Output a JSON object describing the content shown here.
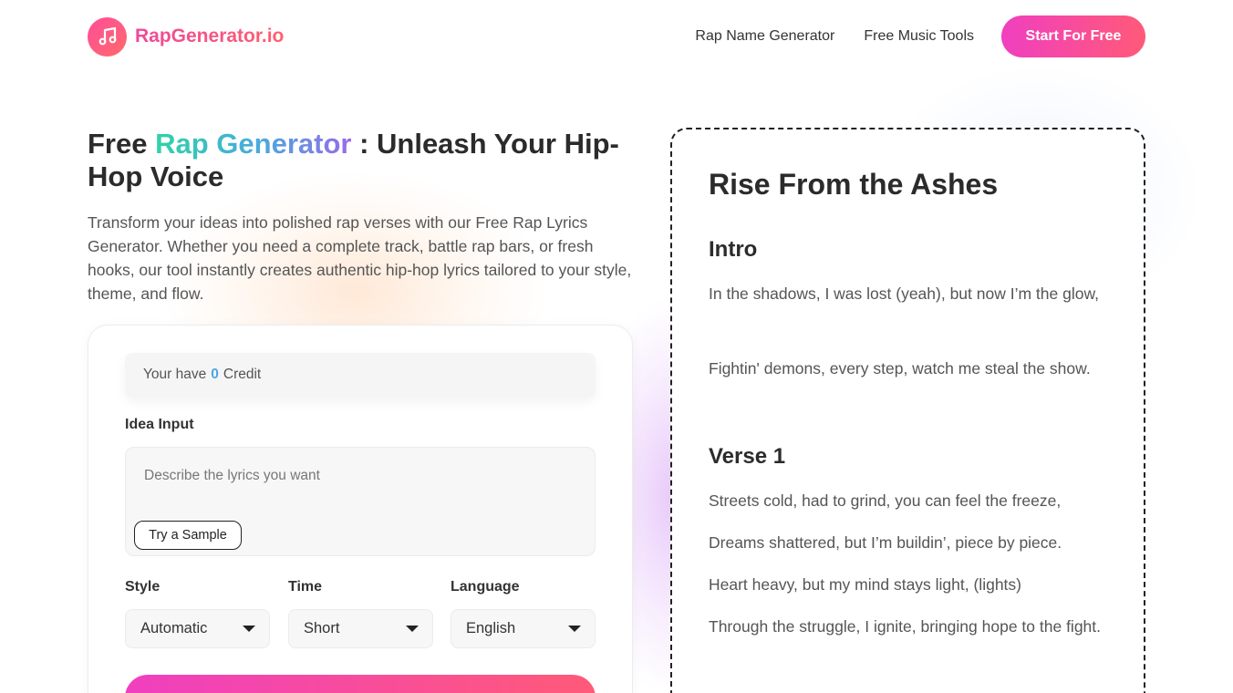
{
  "header": {
    "logo_text": "RapGenerator.io",
    "logo_icon": "music-note-icon",
    "nav": [
      {
        "label": "Rap Name Generator"
      },
      {
        "label": "Free Music Tools"
      }
    ],
    "cta_label": "Start For Free"
  },
  "hero": {
    "title_before": "Free ",
    "title_highlight": "Rap Generator",
    "title_after": " : Unleash Your Hip-Hop Voice",
    "description": "Transform your ideas into polished rap verses with our Free Rap Lyrics Generator. Whether you need a complete track, battle rap bars, or fresh hooks, our tool instantly creates authentic hip-hop lyrics tailored to your style, theme, and flow."
  },
  "form": {
    "credit_prefix": "Your have",
    "credit_count": "0",
    "credit_suffix": "Credit",
    "idea_label": "Idea Input",
    "idea_placeholder": "Describe the lyrics you want",
    "sample_button": "Try a Sample",
    "style_label": "Style",
    "style_value": "Automatic",
    "time_label": "Time",
    "time_value": "Short",
    "language_label": "Language",
    "language_value": "English"
  },
  "song": {
    "title": "Rise From the Ashes",
    "sections": [
      {
        "heading": "Intro",
        "lines": [
          "In the shadows, I was lost (yeah), but now I’m the glow,",
          "Fightin' demons, every step, watch me steal the show."
        ]
      },
      {
        "heading": "Verse 1",
        "lines": [
          "Streets cold, had to grind, you can feel the freeze,",
          "Dreams shattered, but I’m buildin’, piece by piece.",
          "Heart heavy, but my mind stays light, (lights)",
          "Through the struggle, I ignite, bringing hope to the fight."
        ]
      }
    ]
  },
  "colors": {
    "accent_pink": "#f03fc0",
    "accent_coral": "#ff5a78",
    "title_gradient_start": "#2fd3a6",
    "title_gradient_end": "#9a6ae8",
    "credit_number": "#4aa8e0"
  }
}
